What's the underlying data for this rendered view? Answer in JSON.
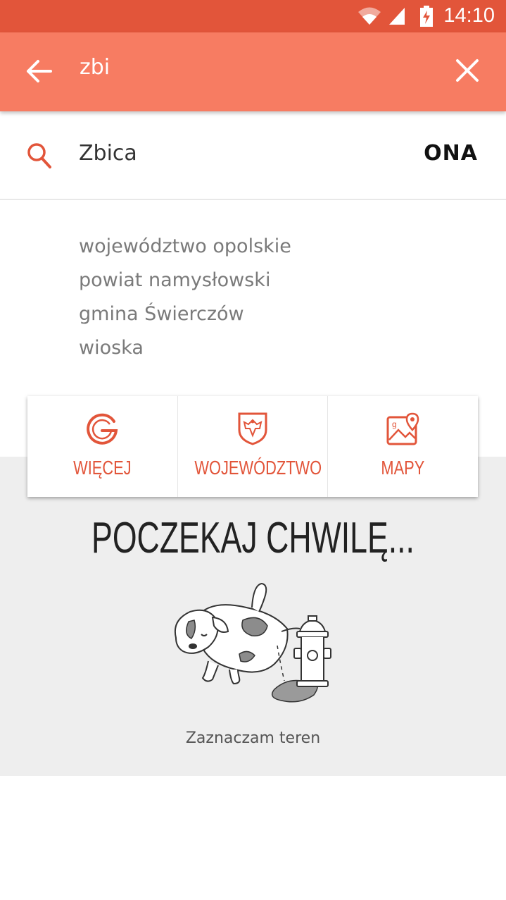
{
  "status_bar": {
    "time": "14:10",
    "icons": [
      "wifi-icon",
      "signal-icon",
      "battery-charging-icon"
    ],
    "color": "#e2553a"
  },
  "search_bar": {
    "query": "zbi",
    "back_icon": "arrow-back-icon",
    "clear_icon": "close-icon",
    "color": "#f77c62"
  },
  "result": {
    "name": "Zbica",
    "gender": "ONA",
    "icon": "search-icon"
  },
  "details": [
    "województwo opolskie",
    "powiat namysłowski",
    "gmina Świerczów",
    "wioska"
  ],
  "actions": [
    {
      "label": "WIĘCEJ",
      "icon": "google-icon"
    },
    {
      "label": "WOJEWÓDZTWO",
      "icon": "coat-of-arms-icon"
    },
    {
      "label": "MAPY",
      "icon": "map-icon"
    }
  ],
  "loading": {
    "title": "POCZEKAJ CHWILĘ...",
    "caption": "Zaznaczam teren",
    "illustration": "dog-hydrant-illustration"
  },
  "accent_color": "#e2553a"
}
